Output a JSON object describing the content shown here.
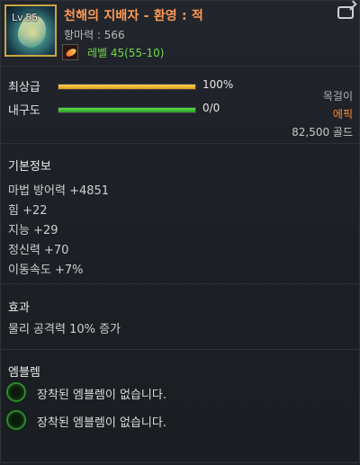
{
  "header": {
    "level_label": "Lv.55",
    "item_name": "천해의 지배자 - 환영 : 적",
    "attack_power": "항마력 : 566",
    "level_requirement": "레벨 45(55-10)",
    "icon_name": "dragon-ornament-icon",
    "class_icon_name": "feather-class-icon",
    "compare_icon_name": "compare-icon"
  },
  "status": {
    "quality_label": "최상급",
    "quality_percent": 100,
    "quality_value": "100%",
    "durability_label": "내구도",
    "durability_percent": 100,
    "durability_value": "0/0",
    "item_type": "목걸이",
    "item_grade": "에픽",
    "item_price": "82,500 골드"
  },
  "base_info": {
    "title": "기본정보",
    "stats": [
      "마법 방어력 +4851",
      "힘 +22",
      "지능 +29",
      "정신력 +70",
      "이동속도 +7%"
    ]
  },
  "effect": {
    "title": "효과",
    "lines": [
      "물리 공격력 10% 증가"
    ]
  },
  "emblem": {
    "title": "엠블렘",
    "slots": [
      "장착된 엠블렘이 없습니다.",
      "장착된 엠블렘이 없습니다."
    ]
  },
  "colors": {
    "item_name": "#ff9a55",
    "grade_epic": "#ff8c34",
    "level_ok": "#70d94f",
    "quality_bar": "#e09a1d",
    "durability_bar": "#2f9b25"
  }
}
